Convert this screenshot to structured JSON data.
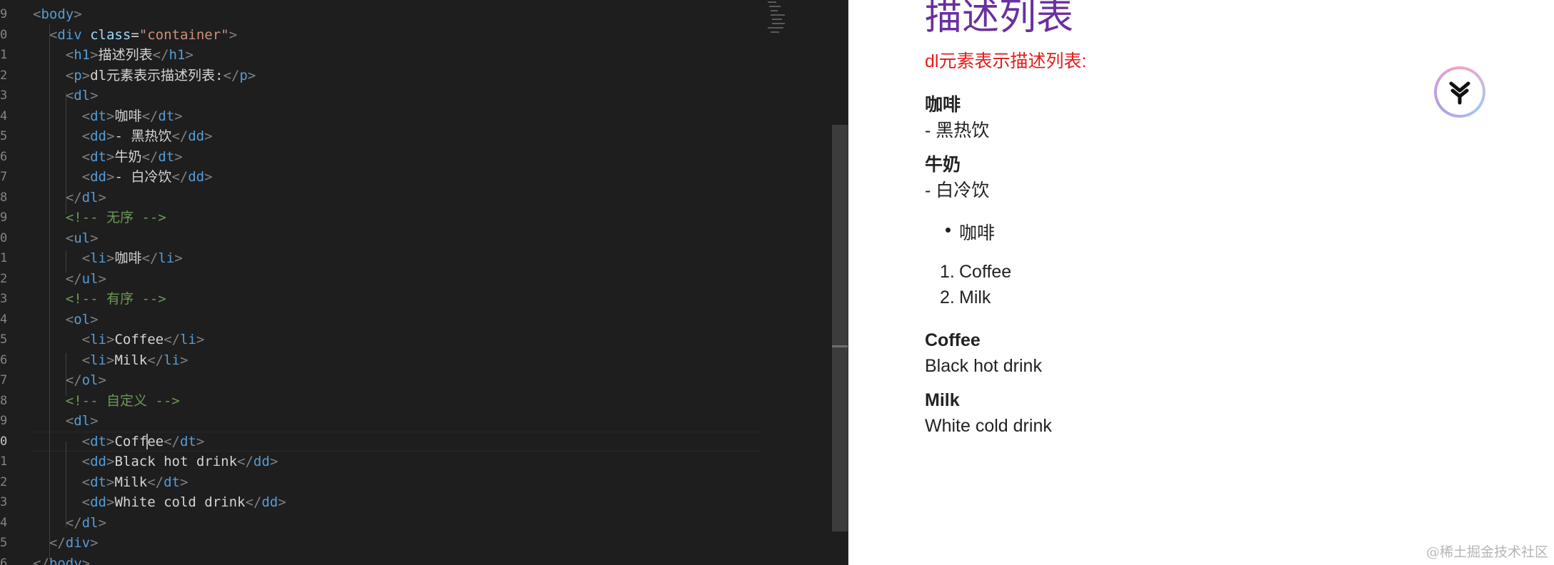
{
  "editor": {
    "lines": [
      {
        "n": "9",
        "tokens": [
          [
            "t-brk",
            "<"
          ],
          [
            "t-tag",
            "body"
          ],
          [
            "t-brk",
            ">"
          ]
        ]
      },
      {
        "n": "0",
        "tokens": [
          [
            "t-txt",
            "  "
          ],
          [
            "t-brk",
            "<"
          ],
          [
            "t-tag",
            "div "
          ],
          [
            "t-attr",
            "class"
          ],
          [
            "t-eq",
            "="
          ],
          [
            "t-str",
            "\"container\""
          ],
          [
            "t-brk",
            ">"
          ]
        ]
      },
      {
        "n": "1",
        "tokens": [
          [
            "t-txt",
            "    "
          ],
          [
            "t-brk",
            "<"
          ],
          [
            "t-tag",
            "h1"
          ],
          [
            "t-brk",
            ">"
          ],
          [
            "t-txt",
            "描述列表"
          ],
          [
            "t-brk",
            "</"
          ],
          [
            "t-tag",
            "h1"
          ],
          [
            "t-brk",
            ">"
          ]
        ]
      },
      {
        "n": "2",
        "tokens": [
          [
            "t-txt",
            "    "
          ],
          [
            "t-brk",
            "<"
          ],
          [
            "t-tag",
            "p"
          ],
          [
            "t-brk",
            ">"
          ],
          [
            "t-txt",
            "dl元素表示描述列表:"
          ],
          [
            "t-brk",
            "</"
          ],
          [
            "t-tag",
            "p"
          ],
          [
            "t-brk",
            ">"
          ]
        ]
      },
      {
        "n": "3",
        "tokens": [
          [
            "t-txt",
            "    "
          ],
          [
            "t-brk",
            "<"
          ],
          [
            "t-tag",
            "dl"
          ],
          [
            "t-brk",
            ">"
          ]
        ]
      },
      {
        "n": "4",
        "tokens": [
          [
            "t-txt",
            "      "
          ],
          [
            "t-brk",
            "<"
          ],
          [
            "t-tag",
            "dt"
          ],
          [
            "t-brk",
            ">"
          ],
          [
            "t-txt",
            "咖啡"
          ],
          [
            "t-brk",
            "</"
          ],
          [
            "t-tag",
            "dt"
          ],
          [
            "t-brk",
            ">"
          ]
        ]
      },
      {
        "n": "5",
        "tokens": [
          [
            "t-txt",
            "      "
          ],
          [
            "t-brk",
            "<"
          ],
          [
            "t-tag",
            "dd"
          ],
          [
            "t-brk",
            ">"
          ],
          [
            "t-txt",
            "- 黑热饮"
          ],
          [
            "t-brk",
            "</"
          ],
          [
            "t-tag",
            "dd"
          ],
          [
            "t-brk",
            ">"
          ]
        ]
      },
      {
        "n": "6",
        "tokens": [
          [
            "t-txt",
            "      "
          ],
          [
            "t-brk",
            "<"
          ],
          [
            "t-tag",
            "dt"
          ],
          [
            "t-brk",
            ">"
          ],
          [
            "t-txt",
            "牛奶"
          ],
          [
            "t-brk",
            "</"
          ],
          [
            "t-tag",
            "dt"
          ],
          [
            "t-brk",
            ">"
          ]
        ]
      },
      {
        "n": "7",
        "tokens": [
          [
            "t-txt",
            "      "
          ],
          [
            "t-brk",
            "<"
          ],
          [
            "t-tag",
            "dd"
          ],
          [
            "t-brk",
            ">"
          ],
          [
            "t-txt",
            "- 白冷饮"
          ],
          [
            "t-brk",
            "</"
          ],
          [
            "t-tag",
            "dd"
          ],
          [
            "t-brk",
            ">"
          ]
        ]
      },
      {
        "n": "8",
        "tokens": [
          [
            "t-txt",
            "    "
          ],
          [
            "t-brk",
            "</"
          ],
          [
            "t-tag",
            "dl"
          ],
          [
            "t-brk",
            ">"
          ]
        ]
      },
      {
        "n": "9",
        "tokens": [
          [
            "t-txt",
            "    "
          ],
          [
            "t-cmt",
            "<!-- 无序 -->"
          ]
        ]
      },
      {
        "n": "0",
        "tokens": [
          [
            "t-txt",
            "    "
          ],
          [
            "t-brk",
            "<"
          ],
          [
            "t-tag",
            "ul"
          ],
          [
            "t-brk",
            ">"
          ]
        ]
      },
      {
        "n": "1",
        "tokens": [
          [
            "t-txt",
            "      "
          ],
          [
            "t-brk",
            "<"
          ],
          [
            "t-tag",
            "li"
          ],
          [
            "t-brk",
            ">"
          ],
          [
            "t-txt",
            "咖啡"
          ],
          [
            "t-brk",
            "</"
          ],
          [
            "t-tag",
            "li"
          ],
          [
            "t-brk",
            ">"
          ]
        ]
      },
      {
        "n": "2",
        "tokens": [
          [
            "t-txt",
            "    "
          ],
          [
            "t-brk",
            "</"
          ],
          [
            "t-tag",
            "ul"
          ],
          [
            "t-brk",
            ">"
          ]
        ]
      },
      {
        "n": "3",
        "tokens": [
          [
            "t-txt",
            "    "
          ],
          [
            "t-cmt",
            "<!-- 有序 -->"
          ]
        ]
      },
      {
        "n": "4",
        "tokens": [
          [
            "t-txt",
            "    "
          ],
          [
            "t-brk",
            "<"
          ],
          [
            "t-tag",
            "ol"
          ],
          [
            "t-brk",
            ">"
          ]
        ]
      },
      {
        "n": "5",
        "tokens": [
          [
            "t-txt",
            "      "
          ],
          [
            "t-brk",
            "<"
          ],
          [
            "t-tag",
            "li"
          ],
          [
            "t-brk",
            ">"
          ],
          [
            "t-txt",
            "Coffee"
          ],
          [
            "t-brk",
            "</"
          ],
          [
            "t-tag",
            "li"
          ],
          [
            "t-brk",
            ">"
          ]
        ]
      },
      {
        "n": "6",
        "tokens": [
          [
            "t-txt",
            "      "
          ],
          [
            "t-brk",
            "<"
          ],
          [
            "t-tag",
            "li"
          ],
          [
            "t-brk",
            ">"
          ],
          [
            "t-txt",
            "Milk"
          ],
          [
            "t-brk",
            "</"
          ],
          [
            "t-tag",
            "li"
          ],
          [
            "t-brk",
            ">"
          ]
        ]
      },
      {
        "n": "7",
        "tokens": [
          [
            "t-txt",
            "    "
          ],
          [
            "t-brk",
            "</"
          ],
          [
            "t-tag",
            "ol"
          ],
          [
            "t-brk",
            ">"
          ]
        ]
      },
      {
        "n": "8",
        "tokens": [
          [
            "t-txt",
            "    "
          ],
          [
            "t-cmt",
            "<!-- 自定义 -->"
          ]
        ]
      },
      {
        "n": "9",
        "tokens": [
          [
            "t-txt",
            "    "
          ],
          [
            "t-brk",
            "<"
          ],
          [
            "t-tag",
            "dl"
          ],
          [
            "t-brk",
            ">"
          ]
        ]
      },
      {
        "n": "0",
        "active": true,
        "tokens": [
          [
            "t-txt",
            "      "
          ],
          [
            "t-brk",
            "<"
          ],
          [
            "t-tag",
            "dt"
          ],
          [
            "t-brk",
            ">"
          ],
          [
            "t-txt",
            "Coff"
          ],
          [
            "cursor",
            ""
          ],
          [
            "t-txt",
            "ee"
          ],
          [
            "t-brk",
            "</"
          ],
          [
            "t-tag",
            "dt"
          ],
          [
            "t-brk",
            ">"
          ]
        ]
      },
      {
        "n": "1",
        "tokens": [
          [
            "t-txt",
            "      "
          ],
          [
            "t-brk",
            "<"
          ],
          [
            "t-tag",
            "dd"
          ],
          [
            "t-brk",
            ">"
          ],
          [
            "t-txt",
            "Black hot drink"
          ],
          [
            "t-brk",
            "</"
          ],
          [
            "t-tag",
            "dd"
          ],
          [
            "t-brk",
            ">"
          ]
        ]
      },
      {
        "n": "2",
        "tokens": [
          [
            "t-txt",
            "      "
          ],
          [
            "t-brk",
            "<"
          ],
          [
            "t-tag",
            "dt"
          ],
          [
            "t-brk",
            ">"
          ],
          [
            "t-txt",
            "Milk"
          ],
          [
            "t-brk",
            "</"
          ],
          [
            "t-tag",
            "dt"
          ],
          [
            "t-brk",
            ">"
          ]
        ]
      },
      {
        "n": "3",
        "tokens": [
          [
            "t-txt",
            "      "
          ],
          [
            "t-brk",
            "<"
          ],
          [
            "t-tag",
            "dd"
          ],
          [
            "t-brk",
            ">"
          ],
          [
            "t-txt",
            "White cold drink"
          ],
          [
            "t-brk",
            "</"
          ],
          [
            "t-tag",
            "dd"
          ],
          [
            "t-brk",
            ">"
          ]
        ]
      },
      {
        "n": "4",
        "tokens": [
          [
            "t-txt",
            "    "
          ],
          [
            "t-brk",
            "</"
          ],
          [
            "t-tag",
            "dl"
          ],
          [
            "t-brk",
            ">"
          ]
        ]
      },
      {
        "n": "5",
        "tokens": [
          [
            "t-txt",
            "  "
          ],
          [
            "t-brk",
            "</"
          ],
          [
            "t-tag",
            "div"
          ],
          [
            "t-brk",
            ">"
          ]
        ]
      },
      {
        "n": "6",
        "tokens": [
          [
            "t-brk",
            "</"
          ],
          [
            "t-tag",
            "body"
          ],
          [
            "t-brk",
            ">"
          ]
        ]
      }
    ]
  },
  "preview": {
    "heading": "描述列表",
    "paragraph": "dl元素表示描述列表:",
    "dl1": [
      {
        "term": "咖啡",
        "desc": "- 黑热饮"
      },
      {
        "term": "牛奶",
        "desc": "- 白冷饮"
      }
    ],
    "ul": [
      "咖啡"
    ],
    "ol": [
      {
        "num": "1.",
        "text": "Coffee"
      },
      {
        "num": "2.",
        "text": "Milk"
      }
    ],
    "dl2": [
      {
        "term": "Coffee",
        "desc": "Black hot drink"
      },
      {
        "term": "Milk",
        "desc": "White cold drink"
      }
    ],
    "watermark": "@稀土掘金技术社区",
    "assistant_icon": "assistant-logo-icon"
  },
  "colors": {
    "editor_bg": "#1e1e1e",
    "tag": "#569cd6",
    "attr": "#9cdcfe",
    "string": "#ce9178",
    "comment": "#6a9955",
    "h1": "#6a2fa0",
    "p_red": "#e31b1b"
  }
}
